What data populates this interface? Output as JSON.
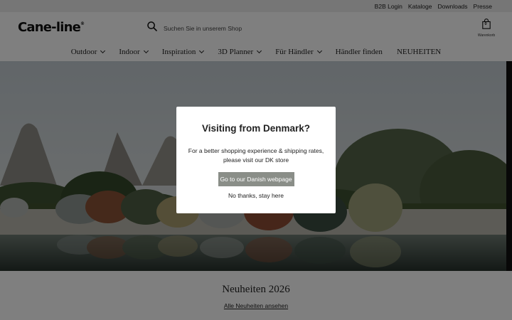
{
  "topbar": {
    "links": [
      "B2B Login",
      "Kataloge",
      "Downloads",
      "Presse"
    ]
  },
  "header": {
    "logo_text": "Cane-line",
    "logo_mark": "®",
    "search_placeholder": "Suchen Sie in unserem Shop",
    "search_icon": "search-icon",
    "cart_count": "0",
    "cart_label": "Warenkorb",
    "cart_icon": "shopping-bag-icon"
  },
  "nav": {
    "items": [
      {
        "label": "Outdoor",
        "has_dropdown": true
      },
      {
        "label": "Indoor",
        "has_dropdown": true
      },
      {
        "label": "Inspiration",
        "has_dropdown": true
      },
      {
        "label": "3D Planner",
        "has_dropdown": true
      },
      {
        "label": "Für Händler",
        "has_dropdown": true
      },
      {
        "label": "Händler finden",
        "has_dropdown": false
      },
      {
        "label": "NEUHEITEN",
        "has_dropdown": false
      }
    ]
  },
  "section": {
    "title": "Neuheiten 2026",
    "link": "Alle Neuheiten ansehen"
  },
  "modal": {
    "title": "Visiting from Denmark?",
    "message": "For a better shopping experience & shipping rates, please visit our DK store",
    "primary_button": "Go to our Danish webpage",
    "secondary_button": "No thanks, stay here",
    "primary_color": "#8a8e88"
  },
  "colors": {
    "topbar_bg": "#ececec",
    "overlay": "rgba(0,0,0,0.5)"
  }
}
